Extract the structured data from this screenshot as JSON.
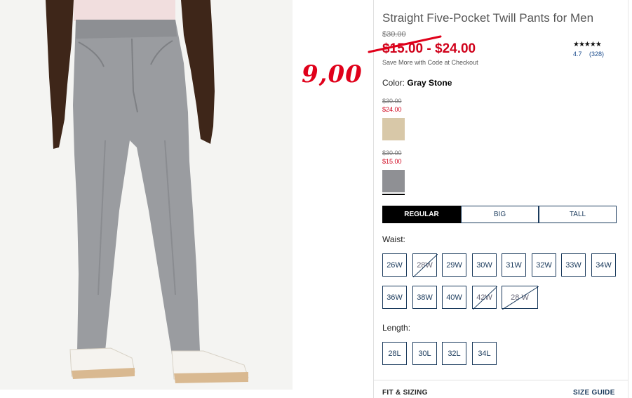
{
  "product": {
    "title": "Straight Five-Pocket Twill Pants for Men",
    "original_price": "$30.00",
    "sale_range": "$15.00 - $24.00",
    "save_more": "Save More with Code at Checkout",
    "handwritten_price": "9,00",
    "rating_stars": "★★★★★",
    "rating_value": "4.7",
    "rating_count": "(328)"
  },
  "color": {
    "label": "Color:",
    "selected": "Gray Stone",
    "swatches": [
      {
        "original": "$30.00",
        "sale": "$24.00",
        "hex": "#d8c8a8",
        "name": "khaki-swatch"
      },
      {
        "original": "$30.00",
        "sale": "$15.00",
        "hex": "#8f9094",
        "name": "gray-stone-swatch",
        "selected": true
      }
    ]
  },
  "fit": {
    "options": [
      "REGULAR",
      "BIG",
      "TALL"
    ],
    "selected": "REGULAR"
  },
  "waist": {
    "label": "Waist:",
    "sizes": [
      "26W",
      "28W",
      "29W",
      "30W",
      "31W",
      "32W",
      "33W",
      "34W",
      "36W",
      "38W",
      "40W",
      "42W",
      "28 W"
    ],
    "unavailable": [
      "28W",
      "42W",
      "28 W"
    ]
  },
  "length": {
    "label": "Length:",
    "sizes": [
      "28L",
      "30L",
      "32L",
      "34L"
    ]
  },
  "footer": {
    "fit_sizing": "FIT & SIZING",
    "size_guide": "SIZE GUIDE"
  },
  "colors": {
    "sale_red": "#d0021b",
    "navy": "#1a3a5c",
    "pants": "#9a9ca0"
  }
}
